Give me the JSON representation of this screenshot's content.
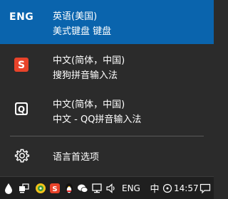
{
  "languages": [
    {
      "code": "ENG",
      "line1": "英语(美国)",
      "line2": "美式键盘 键盘",
      "selected": true
    },
    {
      "icon": "sogou-ime-icon",
      "line1": "中文(简体，中国)",
      "line2": "搜狗拼音输入法"
    },
    {
      "icon": "qq-pinyin-ime-icon",
      "line1": "中文(简体，中国)",
      "line2": "中文 - QQ拼音输入法"
    }
  ],
  "preferences": {
    "icon": "gear-icon",
    "label": "语言首选项"
  },
  "taskbar": {
    "input_indicator": "ENG",
    "time": "14:57",
    "ime_mode": "中",
    "accent": "#0a64ad"
  }
}
